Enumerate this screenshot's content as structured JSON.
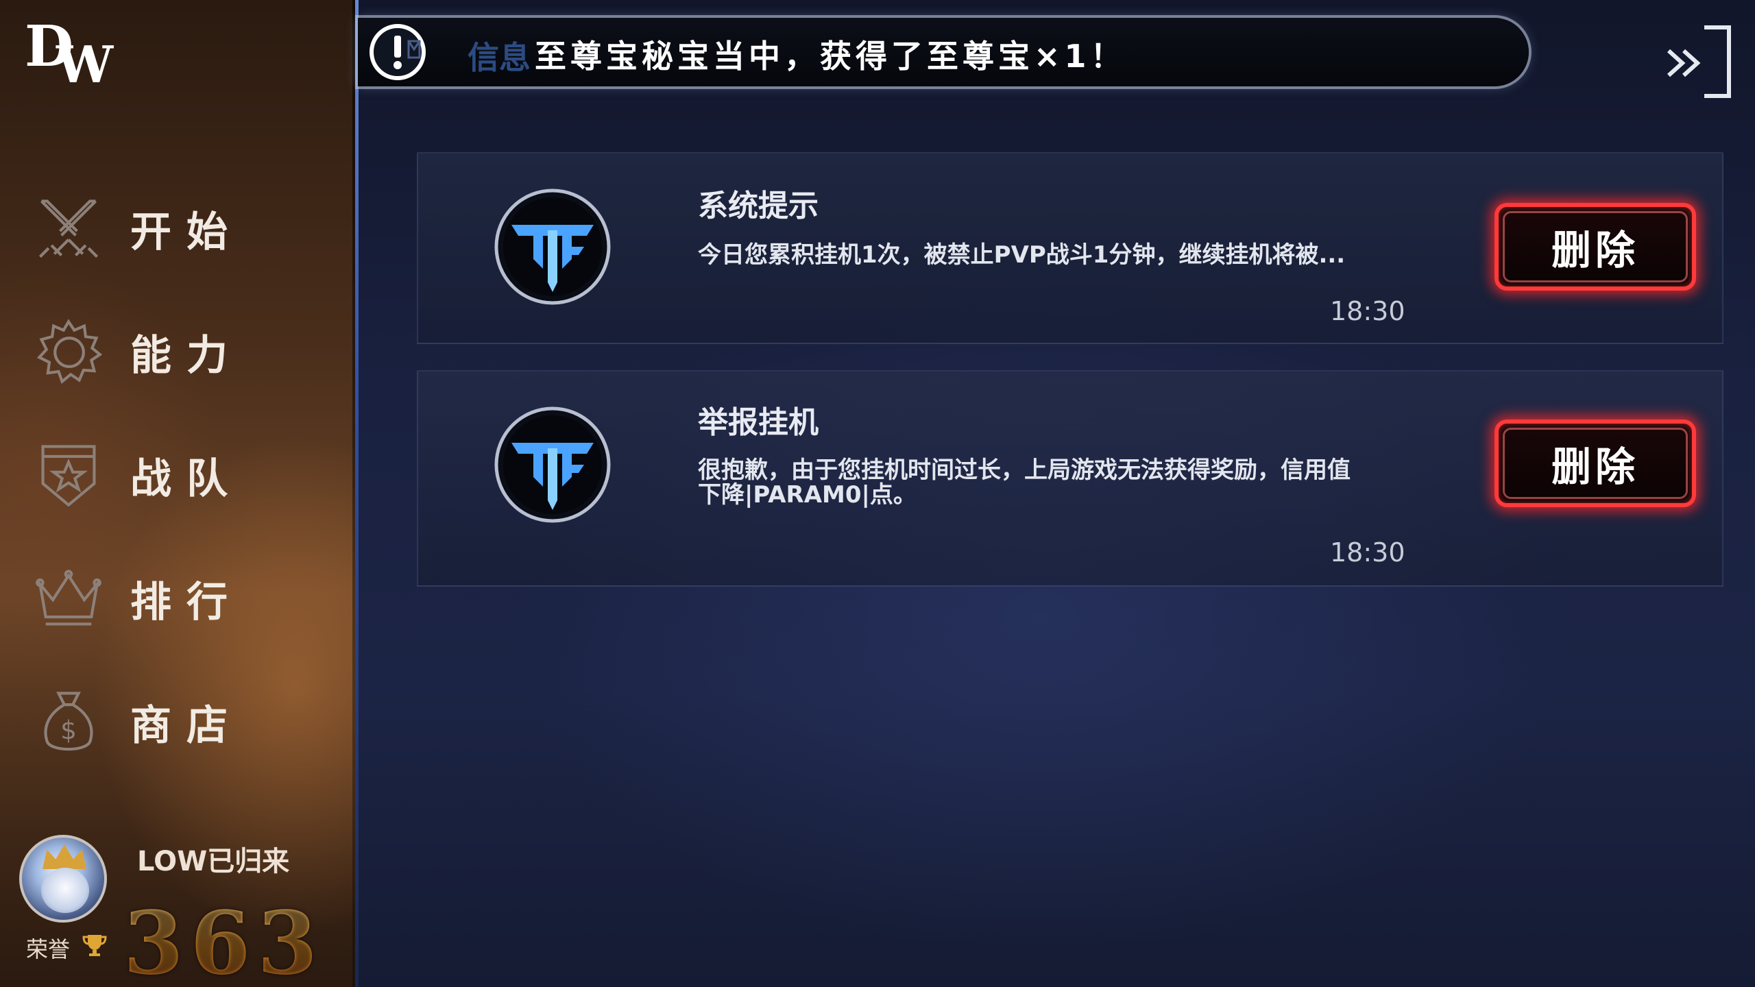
{
  "app": {
    "logo_text_d": "D",
    "logo_text_w": "W"
  },
  "sidebar": {
    "items": [
      {
        "label": "开始",
        "icon": "crossed-swords-icon"
      },
      {
        "label": "能力",
        "icon": "gear-icon"
      },
      {
        "label": "战队",
        "icon": "shield-star-icon"
      },
      {
        "label": "排行",
        "icon": "crown-icon"
      },
      {
        "label": "商店",
        "icon": "money-bag-icon"
      }
    ]
  },
  "profile": {
    "username": "LOW已归来",
    "honor_label": "荣誉",
    "honor_value": "363"
  },
  "notice": {
    "ghost_text": "信息",
    "text": "至尊宝秘宝当中，获得了至尊宝×1！"
  },
  "messages": [
    {
      "title": "系统提示",
      "body": "今日您累积挂机1次，被禁止PVP战斗1分钟，继续挂机将被...",
      "time": "18:30",
      "delete_label": "删除"
    },
    {
      "title": "举报挂机",
      "body_line1": "很抱歉，由于您挂机时间过长，上局游戏无法获得奖励，信用值",
      "body_line2": "下降|PARAM0|点。",
      "time": "18:30",
      "delete_label": "删除"
    }
  ],
  "colors": {
    "accent_red": "#ff3a3a",
    "honor_gold": "#f0a43a",
    "emblem_blue": "#4aa3ff"
  }
}
